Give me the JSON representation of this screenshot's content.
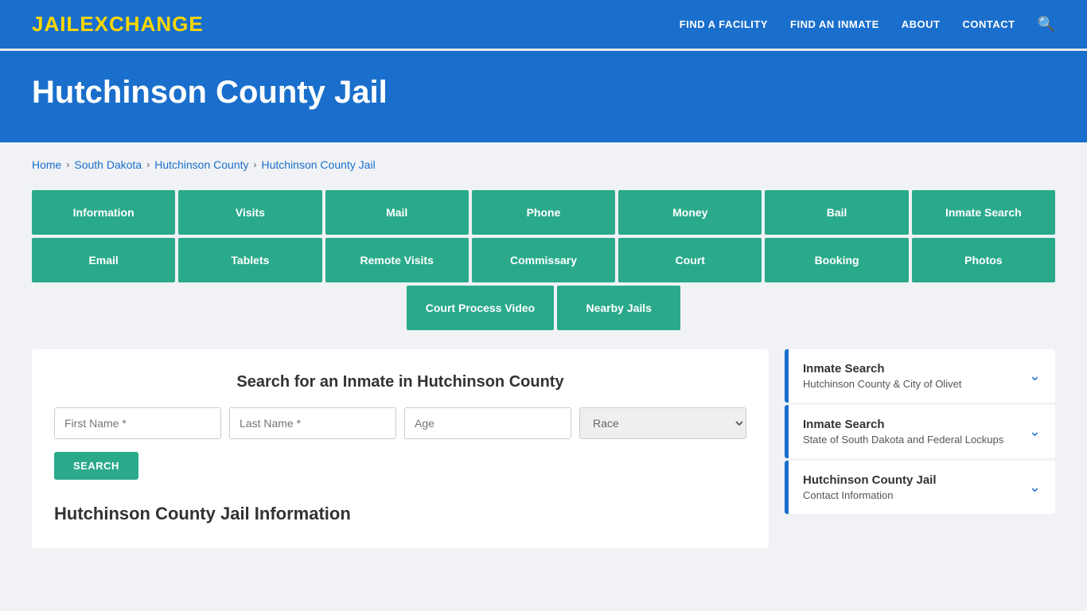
{
  "brand": {
    "name_part1": "JAIL",
    "name_part2": "EXCHANGE"
  },
  "nav": {
    "links": [
      {
        "id": "find-facility",
        "label": "FIND A FACILITY"
      },
      {
        "id": "find-inmate",
        "label": "FIND AN INMATE"
      },
      {
        "id": "about",
        "label": "ABOUT"
      },
      {
        "id": "contact",
        "label": "CONTACT"
      }
    ]
  },
  "hero": {
    "title": "Hutchinson County Jail"
  },
  "breadcrumb": {
    "items": [
      {
        "id": "home",
        "label": "Home"
      },
      {
        "id": "south-dakota",
        "label": "South Dakota"
      },
      {
        "id": "hutchinson-county",
        "label": "Hutchinson County"
      },
      {
        "id": "hutchinson-county-jail",
        "label": "Hutchinson County Jail"
      }
    ]
  },
  "tiles_row1": [
    {
      "id": "information",
      "label": "Information"
    },
    {
      "id": "visits",
      "label": "Visits"
    },
    {
      "id": "mail",
      "label": "Mail"
    },
    {
      "id": "phone",
      "label": "Phone"
    },
    {
      "id": "money",
      "label": "Money"
    },
    {
      "id": "bail",
      "label": "Bail"
    },
    {
      "id": "inmate-search",
      "label": "Inmate Search"
    }
  ],
  "tiles_row2": [
    {
      "id": "email",
      "label": "Email"
    },
    {
      "id": "tablets",
      "label": "Tablets"
    },
    {
      "id": "remote-visits",
      "label": "Remote Visits"
    },
    {
      "id": "commissary",
      "label": "Commissary"
    },
    {
      "id": "court",
      "label": "Court"
    },
    {
      "id": "booking",
      "label": "Booking"
    },
    {
      "id": "photos",
      "label": "Photos"
    }
  ],
  "tiles_row3": [
    {
      "id": "court-process-video",
      "label": "Court Process Video"
    },
    {
      "id": "nearby-jails",
      "label": "Nearby Jails"
    }
  ],
  "search": {
    "title": "Search for an Inmate in Hutchinson County",
    "first_name_placeholder": "First Name *",
    "last_name_placeholder": "Last Name *",
    "age_placeholder": "Age",
    "race_placeholder": "Race",
    "button_label": "SEARCH"
  },
  "sidebar": {
    "cards": [
      {
        "id": "inmate-search-local",
        "title": "Inmate Search",
        "subtitle": "Hutchinson County & City of Olivet"
      },
      {
        "id": "inmate-search-state",
        "title": "Inmate Search",
        "subtitle": "State of South Dakota and Federal Lockups"
      },
      {
        "id": "contact-info",
        "title": "Hutchinson County Jail",
        "subtitle": "Contact Information"
      }
    ]
  },
  "jail_info_heading": "Hutchinson County Jail Information"
}
